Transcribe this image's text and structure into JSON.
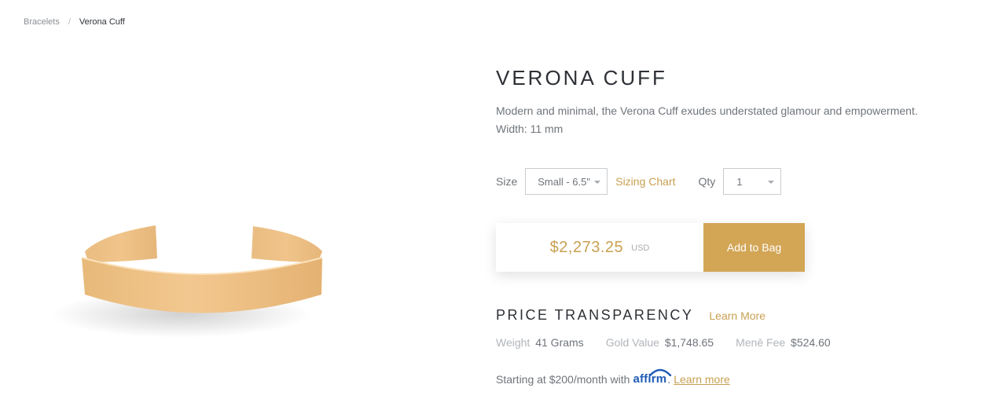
{
  "breadcrumb": {
    "parent": "Bracelets",
    "separator": "/",
    "current": "Verona Cuff"
  },
  "product": {
    "title": "VERONA CUFF",
    "description": "Modern and minimal, the Verona Cuff exudes understated glamour and empowerment.",
    "width_line": "Width: 11 mm",
    "image_alt": "Verona Cuff gold bracelet"
  },
  "options": {
    "size_label": "Size",
    "size_value": "Small - 6.5\"",
    "sizing_chart": "Sizing Chart",
    "qty_label": "Qty",
    "qty_value": "1"
  },
  "purchase": {
    "price": "$2,273.25",
    "currency": "USD",
    "add_to_bag": "Add to Bag"
  },
  "transparency": {
    "title": "PRICE TRANSPARENCY",
    "learn_more": "Learn More",
    "weight_label": "Weight",
    "weight_value": "41 Grams",
    "gold_label": "Gold Value",
    "gold_value": "$1,748.65",
    "fee_label": "Menē Fee",
    "fee_value": "$524.60"
  },
  "financing": {
    "prefix": "Starting at $200/month with",
    "brand": "affirm",
    "suffix": ".",
    "learn_more": "Learn more"
  },
  "colors": {
    "accent": "#d3a656",
    "link": "#c8a052",
    "affirm": "#1f5bb5"
  }
}
